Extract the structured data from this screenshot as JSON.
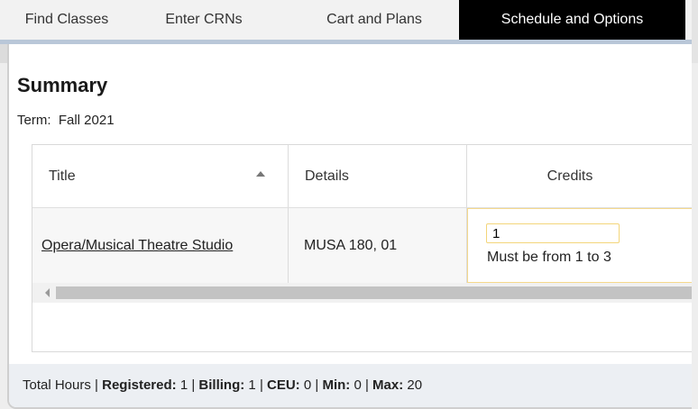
{
  "tabs": [
    {
      "label": "Find Classes"
    },
    {
      "label": "Enter CRNs"
    },
    {
      "label": "Cart and Plans"
    },
    {
      "label": "Schedule and Options",
      "active": true
    }
  ],
  "summary": {
    "title": "Summary",
    "term_label": "Term:",
    "term_value": "Fall 2021"
  },
  "table": {
    "columns": [
      "Title",
      "Details",
      "Credits"
    ],
    "rows": [
      {
        "title": "Opera/Musical Theatre Studio",
        "details": "MUSA 180, 01",
        "credits_value": "1",
        "credits_hint": "Must be from 1 to 3"
      }
    ]
  },
  "footer": {
    "total_hours": "Total Hours",
    "registered_label": "Registered:",
    "registered_value": "1",
    "billing_label": "Billing:",
    "billing_value": "1",
    "ceu_label": "CEU:",
    "ceu_value": "0",
    "min_label": "Min:",
    "min_value": "0",
    "max_label": "Max:",
    "max_value": "20",
    "separator": "|"
  },
  "colors": {
    "active_tab_bg": "#000000",
    "tab_underline": "#b9c7d8",
    "focus_border": "#f3d57a",
    "footer_bg": "#eceff3"
  }
}
